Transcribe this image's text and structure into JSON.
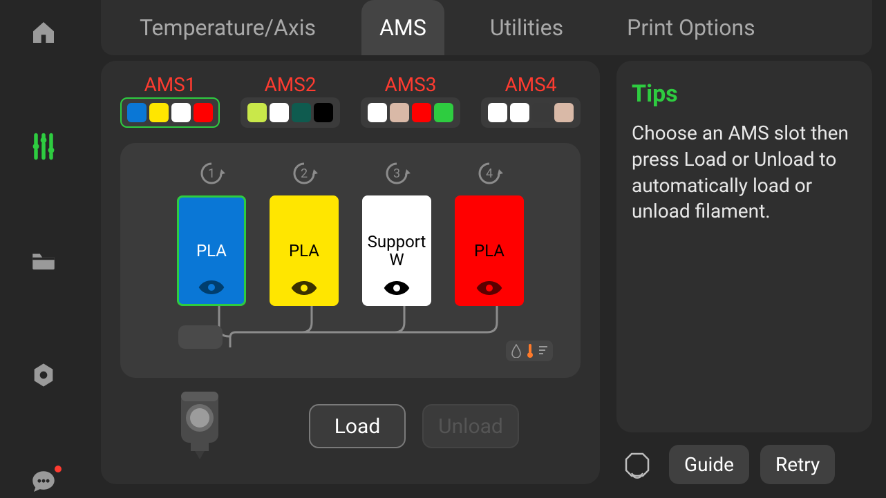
{
  "sidebar": {
    "items": [
      {
        "name": "home-icon"
      },
      {
        "name": "sliders-icon",
        "active": true
      },
      {
        "name": "folder-icon"
      },
      {
        "name": "settings-hex-icon"
      },
      {
        "name": "chat-icon",
        "notification": true
      }
    ]
  },
  "tabs": [
    {
      "label": "Temperature/Axis",
      "active": false
    },
    {
      "label": "AMS",
      "active": true
    },
    {
      "label": "Utilities",
      "active": false
    },
    {
      "label": "Print Options",
      "active": false
    }
  ],
  "ams_units": [
    {
      "label": "AMS1",
      "selected": true,
      "swatches": [
        "#0a77d6",
        "#ffe600",
        "#ffffff",
        "#ff0000"
      ]
    },
    {
      "label": "AMS2",
      "selected": false,
      "swatches": [
        "#c9e84a",
        "#ffffff",
        "#0f5b4f",
        "#000000"
      ]
    },
    {
      "label": "AMS3",
      "selected": false,
      "swatches": [
        "#ffffff",
        "#d9b9a7",
        "#ff0000",
        "#2ecc40"
      ]
    },
    {
      "label": "AMS4",
      "selected": false,
      "swatches": [
        "#ffffff",
        "#ffffff",
        "#3a3a3a",
        "#d9b9a7"
      ]
    }
  ],
  "slots": [
    {
      "number": "1",
      "material": "PLA",
      "bg": "#0a77d6",
      "text": "#ffffff",
      "eye": "#003e6e",
      "selected": true
    },
    {
      "number": "2",
      "material": "PLA",
      "bg": "#ffe600",
      "text": "#000000",
      "eye": "#3b3100",
      "selected": false
    },
    {
      "number": "3",
      "material": "Support W",
      "bg": "#ffffff",
      "text": "#000000",
      "eye": "#000000",
      "selected": false
    },
    {
      "number": "4",
      "material": "PLA",
      "bg": "#ff0000",
      "text": "#000000",
      "eye": "#5a0000",
      "selected": false
    }
  ],
  "buttons": {
    "load": "Load",
    "unload": "Unload"
  },
  "tips": {
    "title": "Tips",
    "body": "Choose an AMS slot then press Load or Unload to automatically load or unload filament."
  },
  "footer": {
    "guide": "Guide",
    "retry": "Retry"
  }
}
